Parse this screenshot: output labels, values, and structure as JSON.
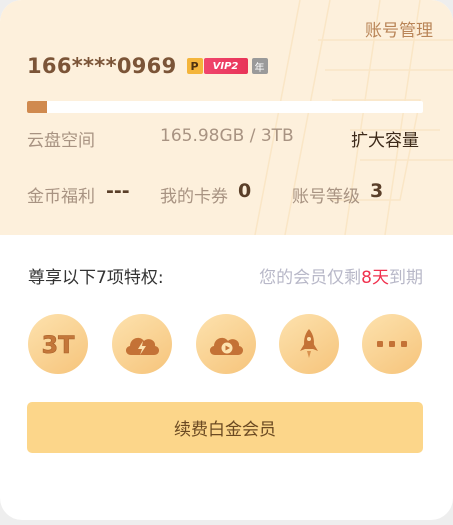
{
  "header": {
    "manage_label": "账号管理",
    "phone": "166****0969",
    "badges": {
      "p": "P",
      "vip": "VIP2",
      "year": "年"
    }
  },
  "storage": {
    "used_fraction": 0.05,
    "label": "云盘空间",
    "usage": "165.98GB / 3TB",
    "expand_label": "扩大容量"
  },
  "stats": {
    "coins_label": "金币福利",
    "coins_value": "---",
    "coupons_label": "我的卡券",
    "coupons_value": "0",
    "level_label": "账号等级",
    "level_value": "3"
  },
  "privileges": {
    "title": "尊享以下7项特权:",
    "remain_prefix": "您的会员仅剩",
    "remain_days": "8天",
    "remain_suffix": "到期",
    "icons": [
      "3t-storage-icon",
      "cloud-speed-icon",
      "cloud-video-icon",
      "rocket-icon",
      "more-icon"
    ]
  },
  "renew_label": "续费白金会员",
  "colors": {
    "accent": "#b98558",
    "banner_bg": "#fdf0dc",
    "button_bg": "#fcd68a",
    "highlight": "#f0324f"
  }
}
